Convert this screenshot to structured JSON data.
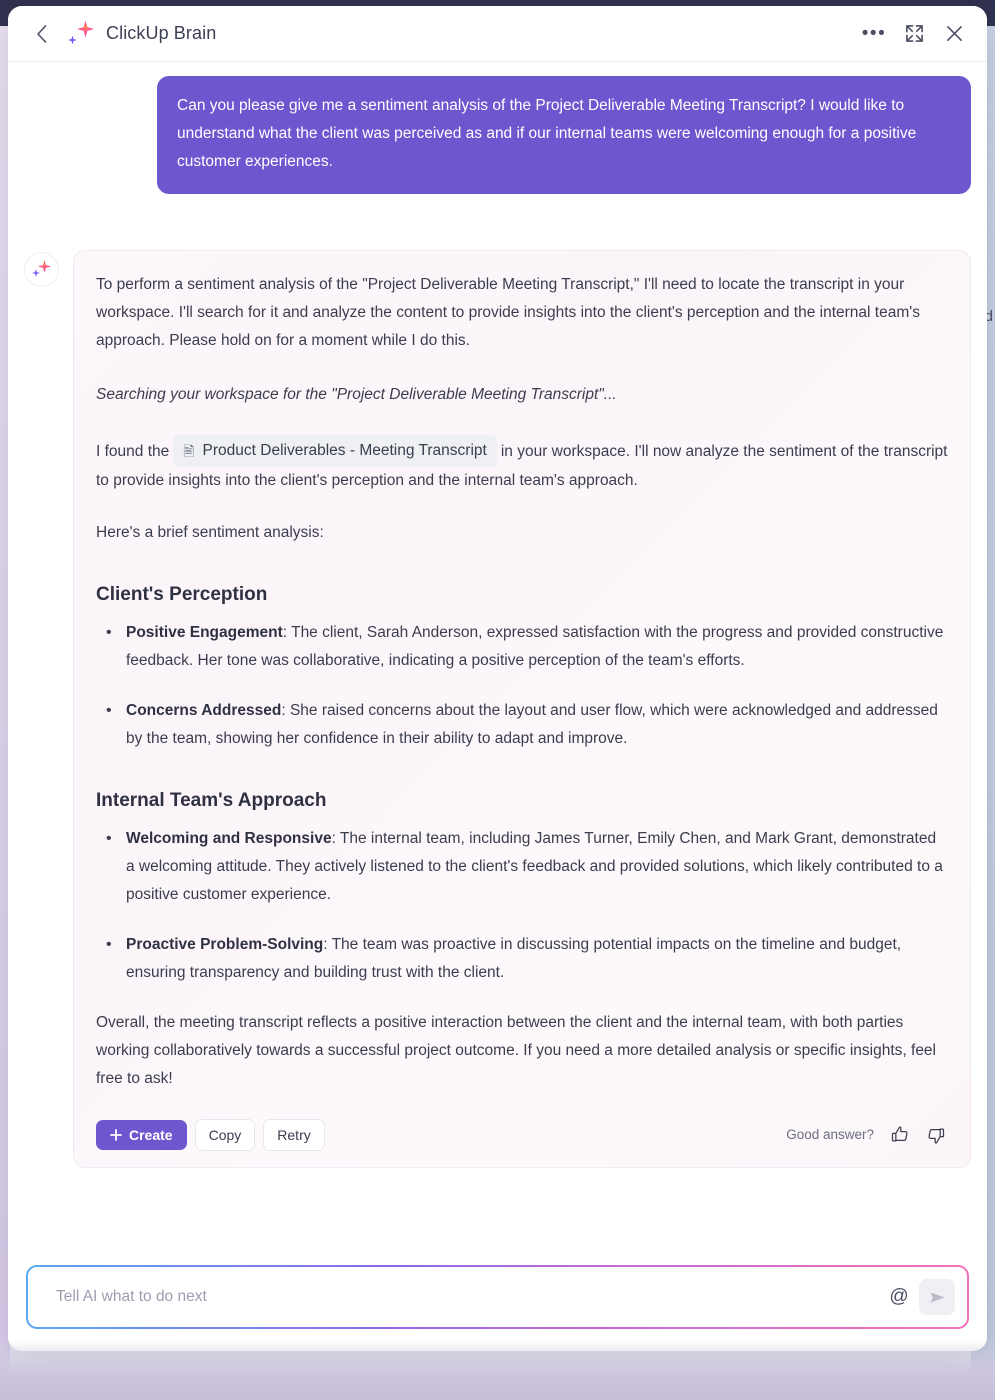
{
  "window": {
    "title": "ClickUp Brain",
    "back_icon": "chevron-left-icon",
    "brand_icon": "sparkle-star-icon",
    "more_icon": "ellipsis-icon",
    "expand_icon": "expand-arrows-icon",
    "close_icon": "close-x-icon",
    "accent_color": "#6e56cf"
  },
  "conversation": {
    "user_message": "Can you please give me a sentiment analysis of the Project Deliverable Meeting Transcript? I would like to understand what the client was perceived as and if our internal teams were welcoming enough for a positive customer experiences.",
    "assistant": {
      "avatar_icon": "sparkle-star-icon",
      "intro": "To perform a sentiment analysis of the \"Project Deliverable Meeting Transcript,\" I'll need to locate the transcript in your workspace. I'll search for it and analyze the content to provide insights into the client's perception and the internal team's approach. Please hold on for a moment while I do this.",
      "searching_status": "Searching your workspace for the \"Project Deliverable Meeting Transcript\"...",
      "found_prefix": "I found the",
      "doc_chip": {
        "icon": "document-icon",
        "label": "Product Deliverables - Meeting Transcript"
      },
      "found_suffix": "in your workspace. I'll now analyze the sentiment of the transcript to provide insights into the client's perception and the internal team's approach.",
      "lead_in": "Here's a brief sentiment analysis:",
      "sections": [
        {
          "heading": "Client's Perception",
          "bullets": [
            {
              "term": "Positive Engagement",
              "text": ": The client, Sarah Anderson, expressed satisfaction with the progress and provided constructive feedback. Her tone was collaborative, indicating a positive perception of the team's efforts."
            },
            {
              "term": "Concerns Addressed",
              "text": ": She raised concerns about the layout and user flow, which were acknowledged and addressed by the team, showing her confidence in their ability to adapt and improve."
            }
          ]
        },
        {
          "heading": "Internal Team's Approach",
          "bullets": [
            {
              "term": "Welcoming and Responsive",
              "text": ": The internal team, including James Turner, Emily Chen, and Mark Grant, demonstrated a welcoming attitude. They actively listened to the client's feedback and provided solutions, which likely contributed to a positive customer experience."
            },
            {
              "term": "Proactive Problem-Solving",
              "text": ": The team was proactive in discussing potential impacts on the timeline and budget, ensuring transparency and building trust with the client."
            }
          ]
        }
      ],
      "summary": "Overall, the meeting transcript reflects a positive interaction between the client and the internal team, with both parties working collaboratively towards a successful project outcome. If you need a more detailed analysis or specific insights, feel free to ask!"
    }
  },
  "actions": {
    "create_label": "Create",
    "create_icon": "plus-icon",
    "copy_label": "Copy",
    "retry_label": "Retry",
    "feedback_label": "Good answer?",
    "thumbs_up_icon": "thumbs-up-icon",
    "thumbs_down_icon": "thumbs-down-icon"
  },
  "composer": {
    "placeholder": "Tell AI what to do next",
    "value": "",
    "mention_icon": "at-mention-icon",
    "send_icon": "send-paper-plane-icon"
  },
  "background": {
    "doc_letter": "d"
  }
}
